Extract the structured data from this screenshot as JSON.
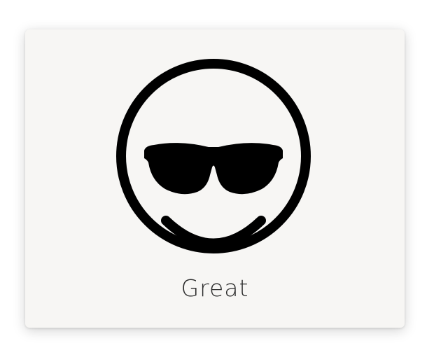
{
  "option": {
    "label": "Great",
    "icon": "sunglasses-smiley-icon"
  },
  "colors": {
    "card_background": "#f7f6f4",
    "icon": "#000000",
    "label": "#2b2b2b"
  }
}
